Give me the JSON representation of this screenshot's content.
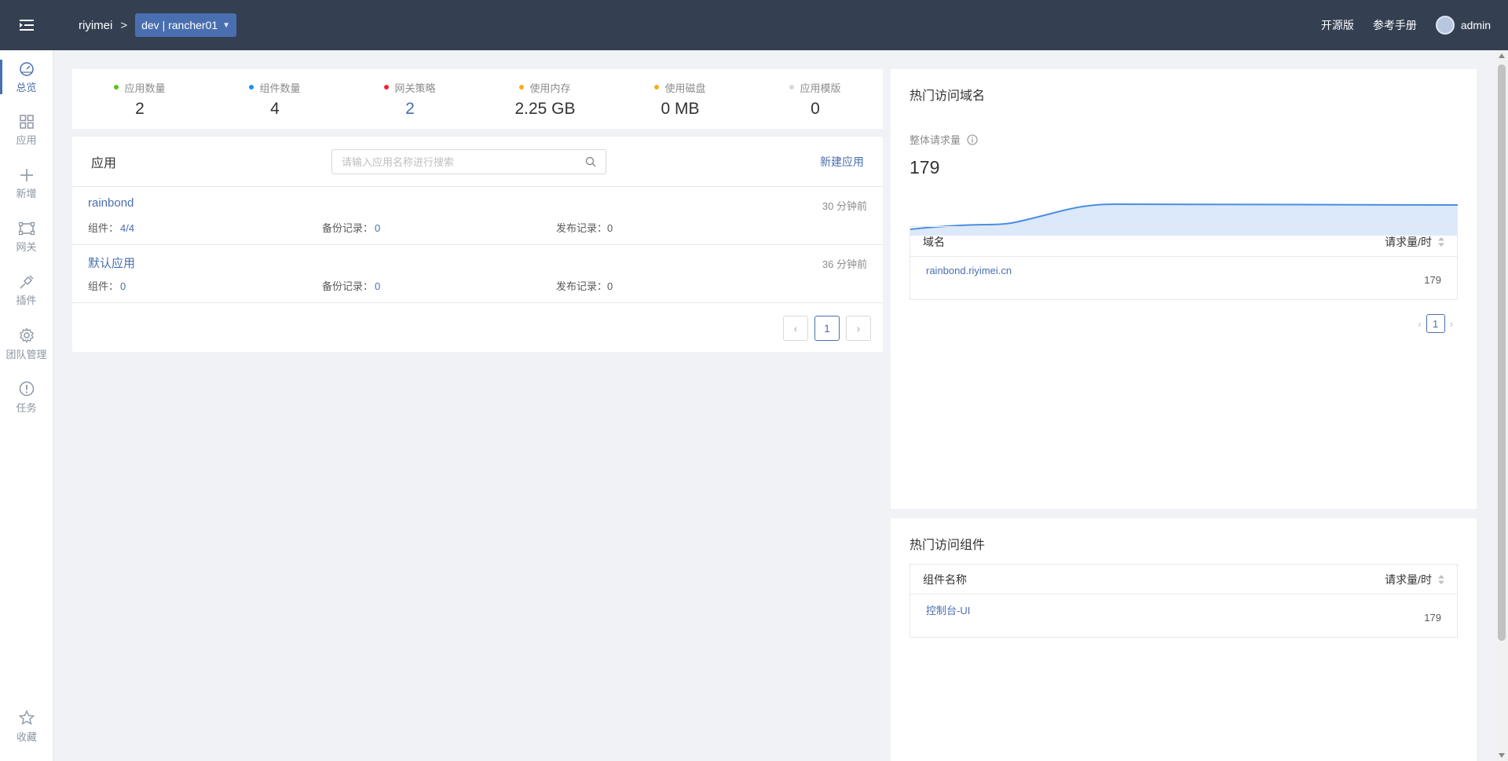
{
  "header": {
    "team": "riyimei",
    "separator": ">",
    "env": "dev | rancher01",
    "links": [
      "开源版",
      "参考手册"
    ],
    "user": "admin"
  },
  "sidebar": {
    "items": [
      {
        "label": "总览",
        "icon": "dashboard-icon"
      },
      {
        "label": "应用",
        "icon": "grid-icon"
      },
      {
        "label": "新增",
        "icon": "plus-icon"
      },
      {
        "label": "网关",
        "icon": "gateway-icon"
      },
      {
        "label": "插件",
        "icon": "plugin-icon"
      },
      {
        "label": "团队管理",
        "icon": "gear-icon"
      },
      {
        "label": "任务",
        "icon": "alert-icon"
      }
    ],
    "bottom": {
      "label": "收藏",
      "icon": "star-icon"
    }
  },
  "stats": [
    {
      "label": "应用数量",
      "value": "2",
      "color": "#52c41a"
    },
    {
      "label": "组件数量",
      "value": "4",
      "color": "#1890ff"
    },
    {
      "label": "网关策略",
      "value": "2",
      "color": "#f5222d"
    },
    {
      "label": "使用内存",
      "value": "2.25 GB",
      "color": "#faad14"
    },
    {
      "label": "使用磁盘",
      "value": "0 MB",
      "color": "#faad14"
    },
    {
      "label": "应用模版",
      "value": "0",
      "color": "#d9d9d9"
    }
  ],
  "apps": {
    "title": "应用",
    "search_placeholder": "请输入应用名称进行搜索",
    "new_label": "新建应用",
    "comp_label": "组件：",
    "backup_label": "备份记录：",
    "publish_label": "发布记录：",
    "rows": [
      {
        "name": "rainbond",
        "time": "30 分钟前",
        "components": "4/4",
        "backups": "0",
        "publishes": "0"
      },
      {
        "name": "默认应用",
        "time": "36 分钟前",
        "components": "0",
        "backups": "0",
        "publishes": "0"
      }
    ],
    "page": "1"
  },
  "domains": {
    "title": "热门访问域名",
    "req_label": "整体请求量",
    "req_value": "179",
    "col_name": "域名",
    "col_req": "请求量/时",
    "rows": [
      {
        "name": "rainbond.riyimei.cn",
        "value": "179"
      }
    ],
    "page": "1"
  },
  "components": {
    "title": "热门访问组件",
    "col_name": "组件名称",
    "col_req": "请求量/时",
    "rows": [
      {
        "name": "控制台-UI",
        "value": "179"
      }
    ]
  }
}
